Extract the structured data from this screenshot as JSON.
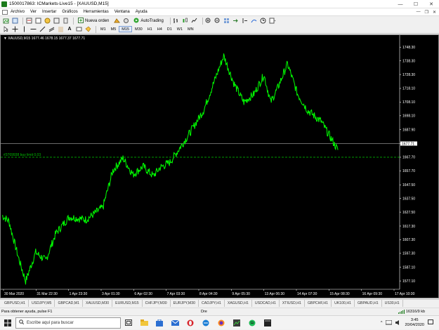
{
  "window": {
    "title": "1500017863: ICMarkets-Live15 - [XAUUSD,M15]",
    "controls": [
      "—",
      "☐",
      "✕"
    ]
  },
  "menu": [
    "Archivo",
    "Ver",
    "Insertar",
    "Gráficos",
    "Herramientas",
    "Ventana",
    "Ayuda"
  ],
  "mdi_controls": [
    "—",
    "❐",
    "✕"
  ],
  "toolbar": {
    "new_order_label": "Nueva orden",
    "autotrading_label": "AutoTrading"
  },
  "timeframes": [
    "M1",
    "M5",
    "M15",
    "M30",
    "H1",
    "H4",
    "D1",
    "W1",
    "MN"
  ],
  "active_timeframe": "M15",
  "chart": {
    "info": "XAUUSD,M15  1677.46 1678.15 1677.37 1677.71",
    "order_label": "#3769938 buy limit 0.03",
    "current_price_tag": "1677.71"
  },
  "chart_data": {
    "type": "line",
    "series": [
      {
        "name": "XAUUSD,M15",
        "color": "#00ff00",
        "x": [
          0,
          2,
          5,
          7,
          10,
          13,
          16,
          20,
          25,
          30,
          33,
          36,
          39,
          42,
          45,
          47,
          50,
          55,
          60,
          63,
          66,
          69,
          72,
          75,
          78,
          80,
          82,
          85,
          88,
          91,
          95,
          100
        ],
        "y": [
          1625,
          1621,
          1593,
          1577,
          1598,
          1592,
          1612,
          1624,
          1622,
          1631,
          1658,
          1667,
          1655,
          1661,
          1654,
          1660,
          1664,
          1682,
          1702,
          1722,
          1742,
          1722,
          1708,
          1714,
          1728,
          1708,
          1718,
          1736,
          1714,
          1702,
          1694,
          1673
        ]
      }
    ],
    "x_ticks": [
      "30 Mar 2020",
      "31 Mar 22:30",
      "1 Apr 23:30",
      "3 Apr 01:30",
      "6 Apr 02:30",
      "7 Apr 03:30",
      "8 Apr 04:30",
      "9 Apr 05:30",
      "13 Apr 06:30",
      "14 Apr 07:30",
      "15 Apr 08:30",
      "16 Apr 09:30",
      "17 Apr 10:30"
    ],
    "y_ticks": [
      "1748.30",
      "1738.30",
      "1728.30",
      "1718.10",
      "1708.10",
      "1698.10",
      "1687.90",
      "1677.71",
      "1667.70",
      "1657.70",
      "1647.50",
      "1637.50",
      "1627.50",
      "1617.30",
      "1607.30",
      "1597.30",
      "1587.10",
      "1577.10"
    ],
    "ylim": [
      1571,
      1752
    ],
    "current_price": 1677.71,
    "order_price": 1667.7
  },
  "symbol_tabs": [
    "GBPUSD,H1",
    "USDJPY,M5",
    "GBPCAD,M1",
    "XAUUSD,M30",
    "EURUSD,M15",
    "CHFJPY,M30",
    "EURJPY,M30",
    "CADJPY,H1",
    "XAGUSD,H1",
    "USDCAD,H1",
    "XTIUSD,H1",
    "GBPCHF,H1",
    "UK100,H1",
    "GBPAUD,H1",
    "US30,H1"
  ],
  "active_tab": "XAUUSD,M15",
  "status": {
    "help": "Para obtener ayuda, pulse F1",
    "profile": "Dre",
    "traffic": "16316/9 kb"
  },
  "taskbar": {
    "search_placeholder": "Escribe aquí para buscar",
    "time": "3:45",
    "date": "20/04/2020"
  },
  "colors": {
    "chart_bg": "#000000",
    "price_line": "#00ff00",
    "order_line": "#00aa00",
    "axis_text": "#ffffff"
  }
}
